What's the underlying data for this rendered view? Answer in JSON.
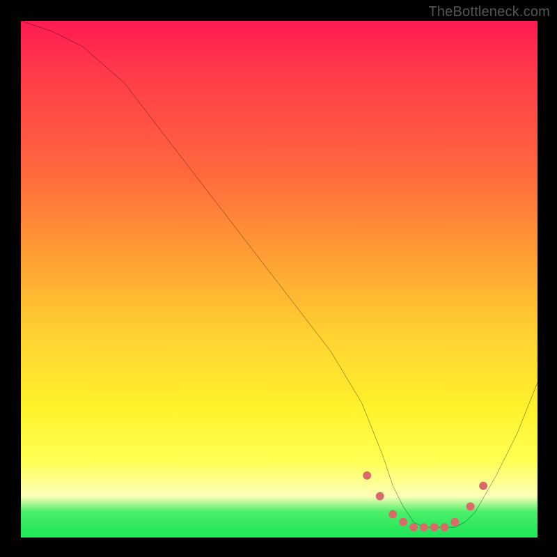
{
  "watermark": "TheBottleneck.com",
  "chart_data": {
    "type": "line",
    "title": "",
    "xlabel": "",
    "ylabel": "",
    "xlim": [
      0,
      100
    ],
    "ylim": [
      0,
      100
    ],
    "grid": false,
    "series": [
      {
        "name": "bottleneck-curve",
        "x": [
          0,
          6,
          12,
          20,
          30,
          40,
          50,
          60,
          66,
          70,
          72,
          74,
          76,
          78,
          80,
          82,
          84,
          86,
          88,
          92,
          96,
          100
        ],
        "y": [
          100,
          98,
          95,
          88,
          75,
          62,
          49,
          36,
          26,
          16,
          10,
          6,
          3,
          2,
          2,
          2,
          2,
          3,
          5,
          12,
          20,
          30
        ]
      }
    ],
    "markers": {
      "name": "optimal-range-dots",
      "color": "#d86a6a",
      "x": [
        67,
        69.5,
        72,
        74,
        76,
        78,
        80,
        82,
        84,
        87,
        89.5
      ],
      "y": [
        12,
        8,
        4.5,
        3,
        2,
        2,
        2,
        2,
        3,
        6,
        10
      ]
    },
    "gradient_colors": {
      "top": "#ff1a52",
      "mid_high": "#ff6a3c",
      "mid": "#ffd531",
      "mid_low": "#ffff53",
      "bottom_band": "#2de85e"
    }
  }
}
